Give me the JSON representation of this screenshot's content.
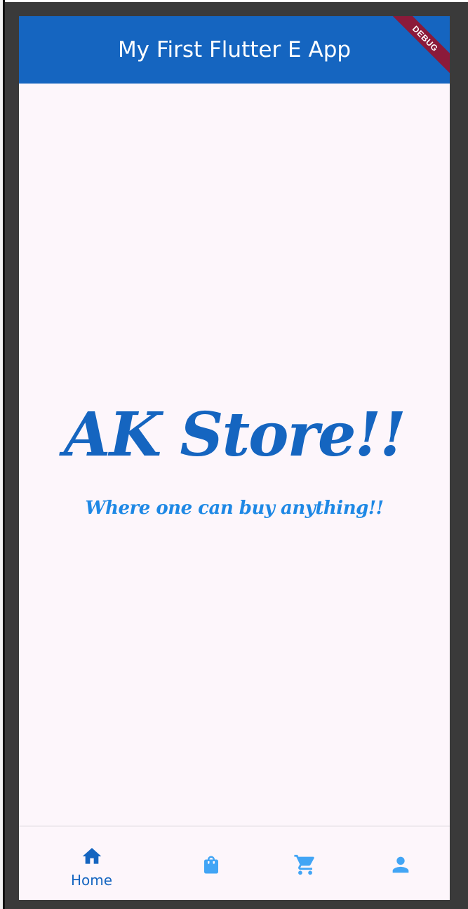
{
  "app": {
    "title": "My First Flutter E App",
    "debug_banner": "DEBUG"
  },
  "main": {
    "brand": "AK Store!!",
    "tagline": "Where one can buy anything!!"
  },
  "bottom_nav": {
    "items": [
      {
        "label": "Home",
        "icon": "home-icon",
        "selected": true
      },
      {
        "label": "",
        "icon": "shopping-bag-icon",
        "selected": false
      },
      {
        "label": "",
        "icon": "cart-icon",
        "selected": false
      },
      {
        "label": "",
        "icon": "person-icon",
        "selected": false
      }
    ]
  },
  "colors": {
    "primary": "#1565c0",
    "accent": "#1e88e5",
    "background": "#fdf6fb",
    "debug_ribbon": "#8b1a3a"
  }
}
